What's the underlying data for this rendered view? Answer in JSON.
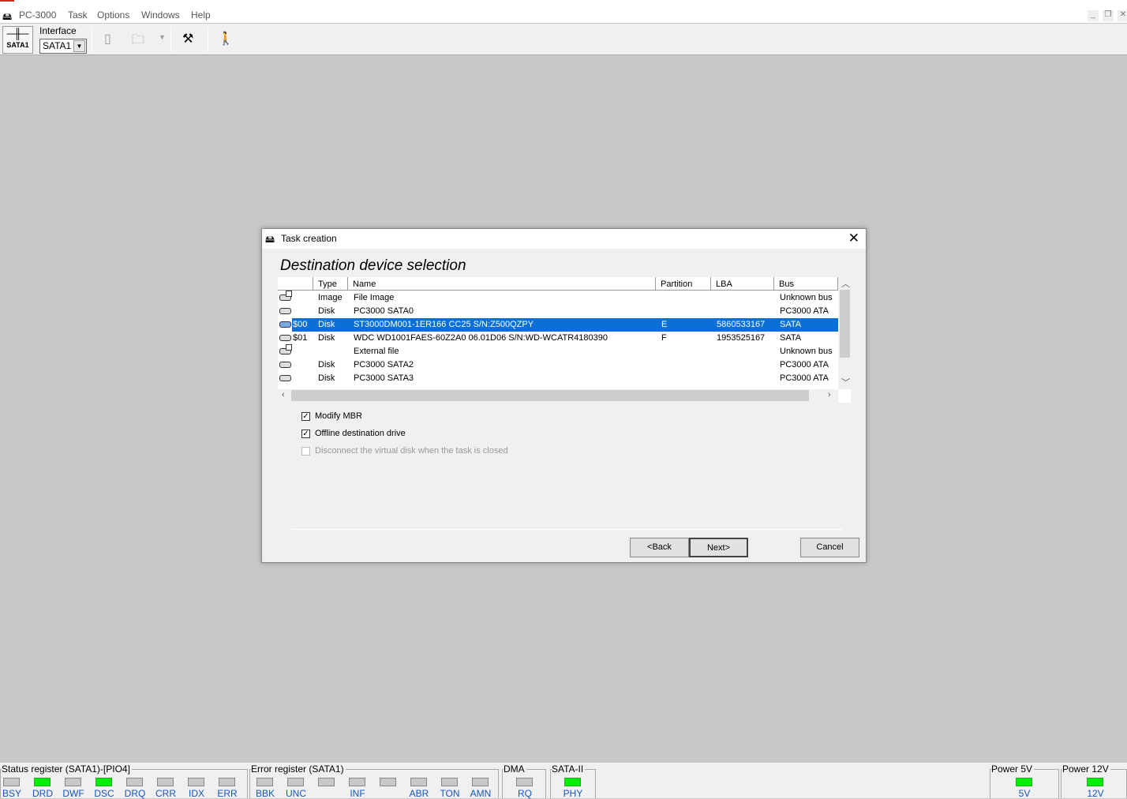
{
  "app": {
    "title": "PC-3000",
    "menu": [
      "Task",
      "Options",
      "Windows",
      "Help"
    ]
  },
  "toolbar": {
    "sata_button": "SATA1",
    "interface_label": "Interface",
    "interface_value": "SATA1"
  },
  "dialog": {
    "title": "Task creation",
    "heading": "Destination device selection",
    "columns": [
      "",
      "Type",
      "Name",
      "Partition",
      "LBA",
      "Bus"
    ],
    "rows": [
      {
        "icon": "image",
        "id": "",
        "type": "Image",
        "name": "File Image",
        "partition": "",
        "lba": "",
        "bus": "Unknown bus"
      },
      {
        "icon": "disk",
        "id": "",
        "type": "Disk",
        "name": "PC3000 SATA0",
        "partition": "",
        "lba": "",
        "bus": "PC3000 ATA"
      },
      {
        "icon": "disk",
        "id": "$00",
        "type": "Disk",
        "name": "ST3000DM001-1ER166 CC25 S/N:Z500QZPY",
        "partition": "E",
        "lba": "5860533167",
        "bus": "SATA",
        "selected": true
      },
      {
        "icon": "disk",
        "id": "$01",
        "type": "Disk",
        "name": "WDC WD1001FAES-60Z2A0 06.01D06 S/N:WD-WCATR4180390",
        "partition": "F",
        "lba": "1953525167",
        "bus": "SATA"
      },
      {
        "icon": "image",
        "id": "",
        "type": "",
        "name": "External file",
        "partition": "",
        "lba": "",
        "bus": "Unknown bus"
      },
      {
        "icon": "disk",
        "id": "",
        "type": "Disk",
        "name": "PC3000 SATA2",
        "partition": "",
        "lba": "",
        "bus": "PC3000 ATA"
      },
      {
        "icon": "disk",
        "id": "",
        "type": "Disk",
        "name": "PC3000 SATA3",
        "partition": "",
        "lba": "",
        "bus": "PC3000 ATA"
      }
    ],
    "options": [
      {
        "label": "Modify MBR",
        "checked": true,
        "enabled": true
      },
      {
        "label": "Offline destination drive",
        "checked": true,
        "enabled": true
      },
      {
        "label": "Disconnect the virtual disk when the task is closed",
        "checked": false,
        "enabled": false
      }
    ],
    "back": "<Back",
    "next": "Next>",
    "cancel": "Cancel"
  },
  "status": {
    "groups": [
      {
        "title": "Status register (SATA1)-[PIO4]",
        "leds": [
          [
            "BSY",
            false
          ],
          [
            "DRD",
            true
          ],
          [
            "DWF",
            false
          ],
          [
            "DSC",
            true
          ],
          [
            "DRQ",
            false
          ],
          [
            "CRR",
            false
          ],
          [
            "IDX",
            false
          ],
          [
            "ERR",
            false
          ]
        ]
      },
      {
        "title": "Error register (SATA1)",
        "leds": [
          [
            "BBK",
            false
          ],
          [
            "UNC",
            false
          ],
          [
            "",
            false
          ],
          [
            "INF",
            false
          ],
          [
            "",
            false
          ],
          [
            "ABR",
            false
          ],
          [
            "TON",
            false
          ],
          [
            "AMN",
            false
          ]
        ]
      },
      {
        "title": "DMA",
        "leds": [
          [
            "RQ",
            false
          ]
        ]
      },
      {
        "title": "SATA-II",
        "leds": [
          [
            "PHY",
            true
          ]
        ]
      },
      {
        "title": "Power 5V",
        "leds": [
          [
            "5V",
            true
          ]
        ]
      },
      {
        "title": "Power 12V",
        "leds": [
          [
            "12V",
            true
          ]
        ]
      }
    ]
  },
  "colors": {
    "selection": "#0a6fd6",
    "led_on": "#00ee00"
  }
}
